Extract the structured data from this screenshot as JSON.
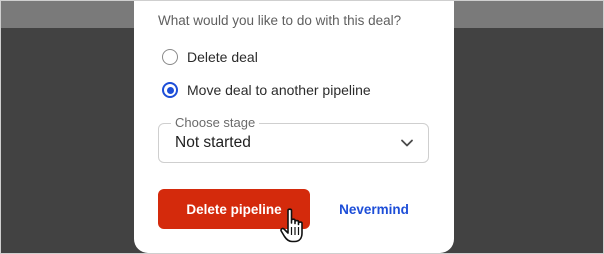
{
  "modal": {
    "question": "What would you like to do with this deal?",
    "options": [
      {
        "label": "Delete deal",
        "checked": false
      },
      {
        "label": "Move deal to another pipeline",
        "checked": true
      }
    ],
    "stage_select": {
      "legend": "Choose stage",
      "value": "Not started"
    },
    "primary_button": "Delete pipeline",
    "secondary_button": "Nevermind"
  },
  "colors": {
    "primary": "#d42a0c",
    "link": "#1d4ed8",
    "backdrop": "#424242"
  },
  "icons": {
    "select": "chevron-down-icon",
    "cursor": "hand-pointer-icon"
  }
}
